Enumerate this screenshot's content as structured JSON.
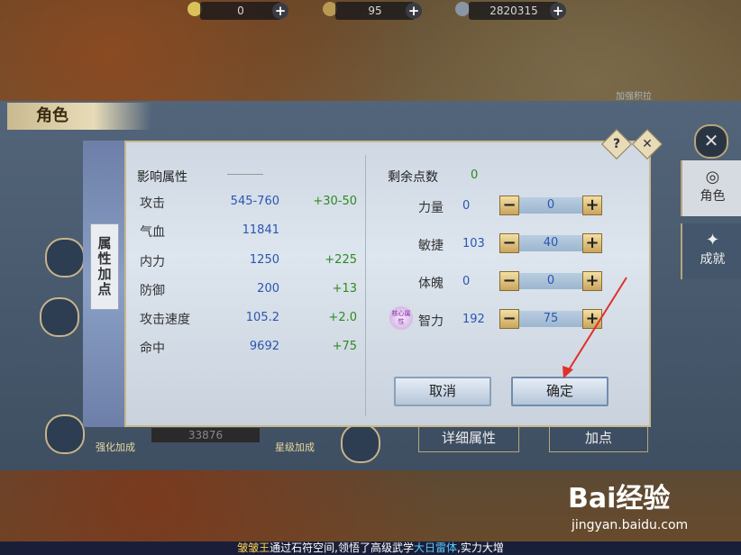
{
  "top_resources": [
    {
      "value": "0"
    },
    {
      "value": "95"
    },
    {
      "value": "2820315"
    }
  ],
  "top_link": "加强积拉",
  "char_window": {
    "title": "角色",
    "tabs": [
      "角色",
      "成就"
    ],
    "buttons": {
      "detail": "详细属性",
      "add_point": "加点"
    },
    "labels": {
      "enhance": "强化加成",
      "star": "星级加成"
    },
    "power_number": "33876"
  },
  "dialog": {
    "tab_label": "属性加点",
    "influence_title": "影响属性",
    "stats": [
      {
        "name": "攻击",
        "value": "545-760",
        "bonus": "+30-50"
      },
      {
        "name": "气血",
        "value": "11841",
        "bonus": ""
      },
      {
        "name": "内力",
        "value": "1250",
        "bonus": "+225"
      },
      {
        "name": "防御",
        "value": "200",
        "bonus": "+13"
      },
      {
        "name": "攻击速度",
        "value": "105.2",
        "bonus": "+2.0"
      },
      {
        "name": "命中",
        "value": "9692",
        "bonus": "+75"
      }
    ],
    "remaining_label": "剩余点数",
    "remaining_value": "0",
    "attributes": [
      {
        "name": "力量",
        "value": "0",
        "alloc": "0"
      },
      {
        "name": "敏捷",
        "value": "103",
        "alloc": "40"
      },
      {
        "name": "体魄",
        "value": "0",
        "alloc": "0"
      },
      {
        "name": "智力",
        "value": "192",
        "alloc": "75"
      }
    ],
    "core_badge": "核心属性",
    "cancel": "取消",
    "confirm": "确定",
    "help": "?"
  },
  "watermark": {
    "brand": "Bai经验",
    "url": "jingyan.baidu.com"
  },
  "ticker": {
    "name": "皱皱王",
    "text1": "通过石符空间,领悟了高级武学",
    "skill": "大日雷体",
    "text2": ",实力大增"
  }
}
